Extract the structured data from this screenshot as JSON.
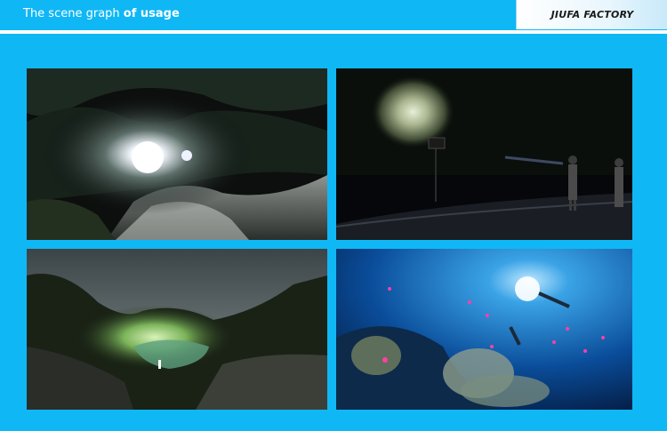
{
  "header": {
    "title_part1": "The scene graph ",
    "title_part2": "of usage",
    "brand": "JIUFA FACTORY"
  },
  "colors": {
    "background": "#10b7f5",
    "header_text": "#ffffff",
    "brand_text": "#1a1a1a"
  }
}
